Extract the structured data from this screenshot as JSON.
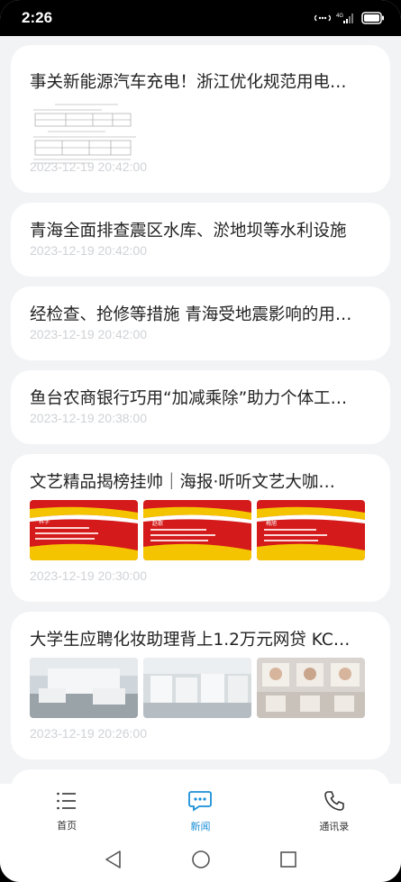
{
  "status": {
    "time": "2:26",
    "network": "4G"
  },
  "news": [
    {
      "title": "事关新能源汽车充电！浙江优化规范用电…",
      "time": "2023-12-19 20:42:00",
      "media": "document"
    },
    {
      "title": "青海全面排查震区水库、淤地坝等水利设施",
      "time": "2023-12-19 20:42:00",
      "media": "none"
    },
    {
      "title": "经检查、抢修等措施 青海受地震影响的用…",
      "time": "2023-12-19 20:42:00",
      "media": "none"
    },
    {
      "title": "鱼台农商银行巧用“加减乘除”助力个体工…",
      "time": "2023-12-19 20:38:00",
      "media": "none"
    },
    {
      "title": "文艺精品揭榜挂帅｜海报·听听文艺大咖…",
      "time": "2023-12-19 20:30:00",
      "media": "posters",
      "poster_labels": [
        "科学",
        "赵歌",
        "梅旭"
      ]
    },
    {
      "title": "大学生应聘化妆助理背上1.2万元网贷 KC…",
      "time": "2023-12-19 20:26:00",
      "media": "photos"
    }
  ],
  "tabs": [
    {
      "label": "首页",
      "icon": "list-icon",
      "active": false
    },
    {
      "label": "新闻",
      "icon": "chat-icon",
      "active": true
    },
    {
      "label": "通讯录",
      "icon": "phone-icon",
      "active": false
    }
  ],
  "colors": {
    "accent": "#1a8fd6",
    "background": "#f1f3f5",
    "time": "#cfd2d6"
  }
}
